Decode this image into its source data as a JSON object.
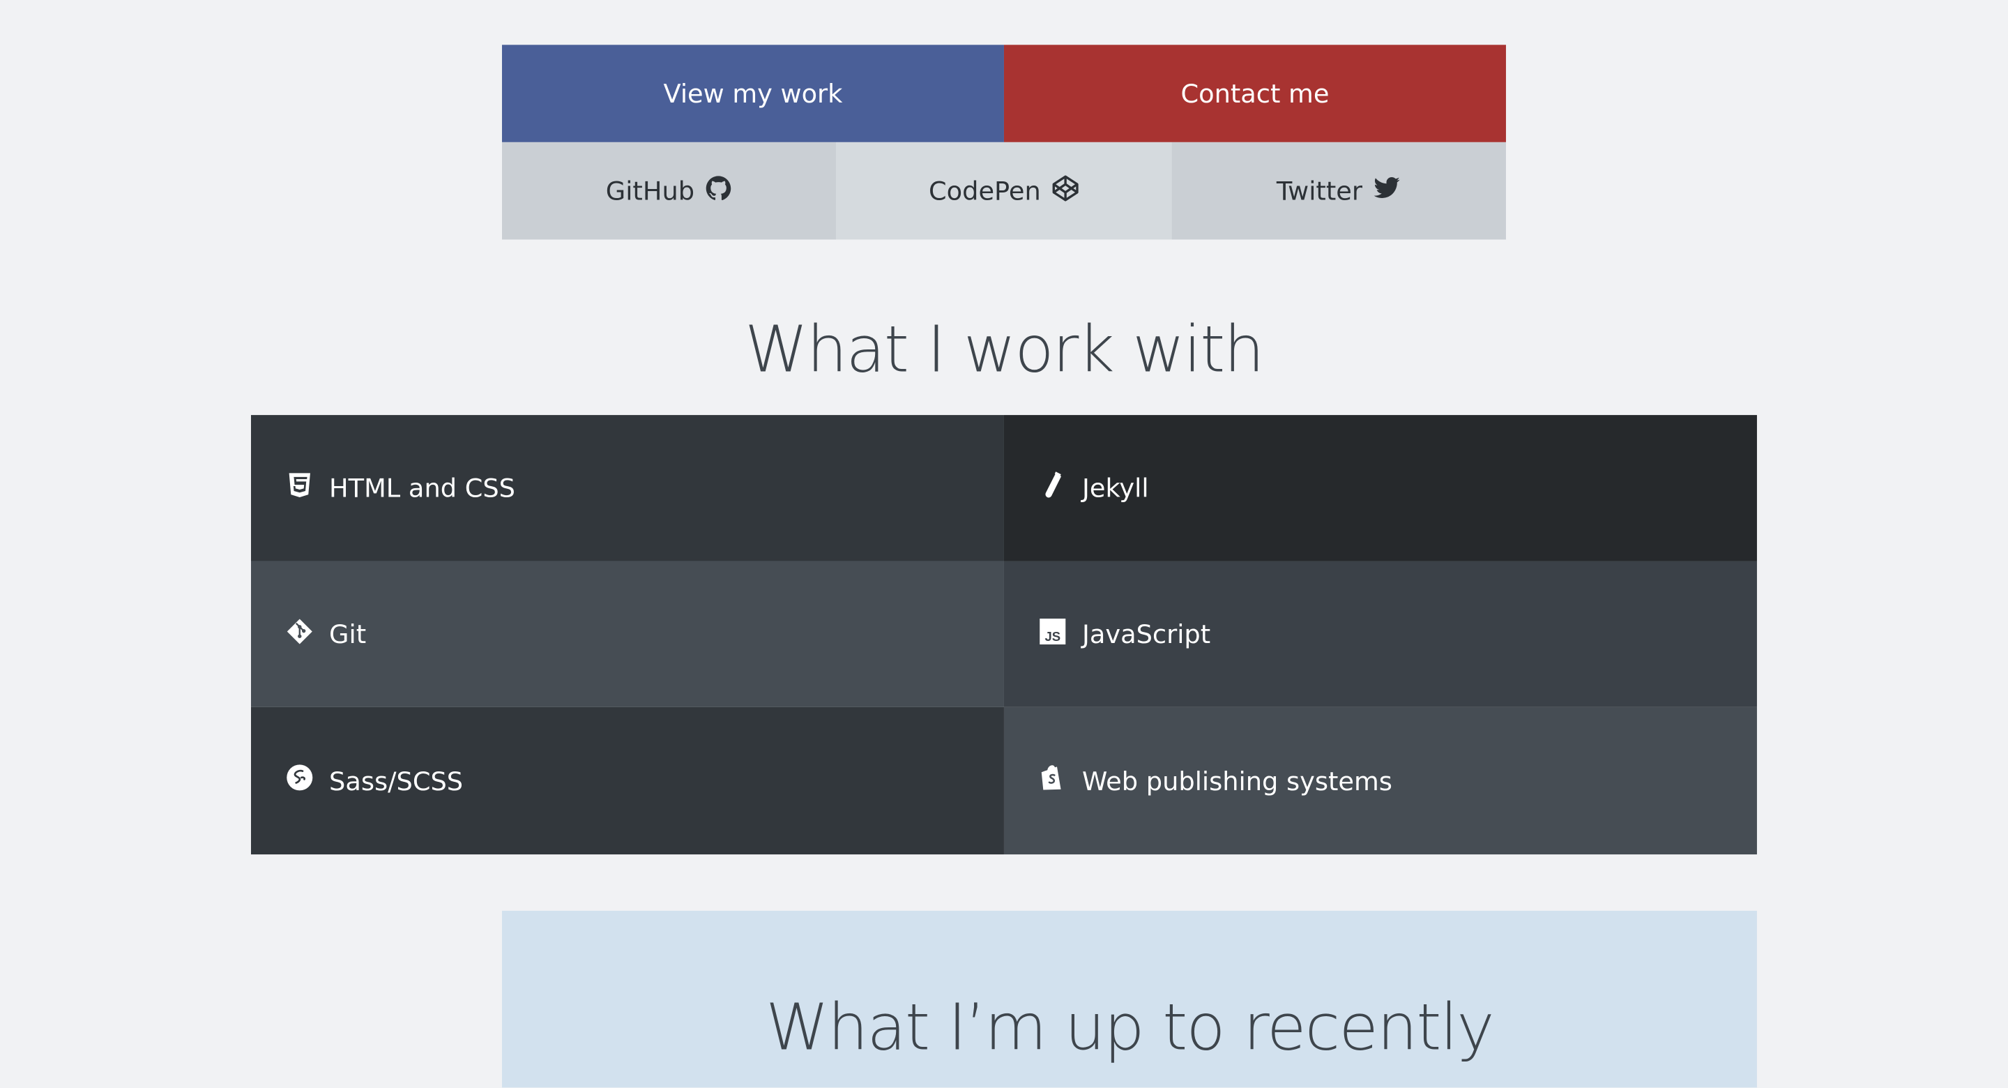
{
  "cta": {
    "view_work": "View my work",
    "contact": "Contact me"
  },
  "social": {
    "github": "GitHub",
    "codepen": "CodePen",
    "twitter": "Twitter"
  },
  "skills_section": {
    "heading": "What I work with",
    "items": [
      {
        "label": "HTML and CSS",
        "icon": "html5-icon"
      },
      {
        "label": "Jekyll",
        "icon": "test-tube-icon"
      },
      {
        "label": "Git",
        "icon": "git-icon"
      },
      {
        "label": "JavaScript",
        "icon": "js-icon"
      },
      {
        "label": "Sass/SCSS",
        "icon": "sass-icon"
      },
      {
        "label": "Web publishing systems",
        "icon": "shopify-bag-icon"
      }
    ]
  },
  "recent_section": {
    "heading": "What I’m up to recently"
  },
  "colors": {
    "background": "#f1f2f4",
    "view_work_button": "#4a5f98",
    "contact_button": "#a83331",
    "social_bg": "#cacfd4",
    "recent_bg": "#d2e1ee",
    "heading_text": "#3e454c"
  }
}
